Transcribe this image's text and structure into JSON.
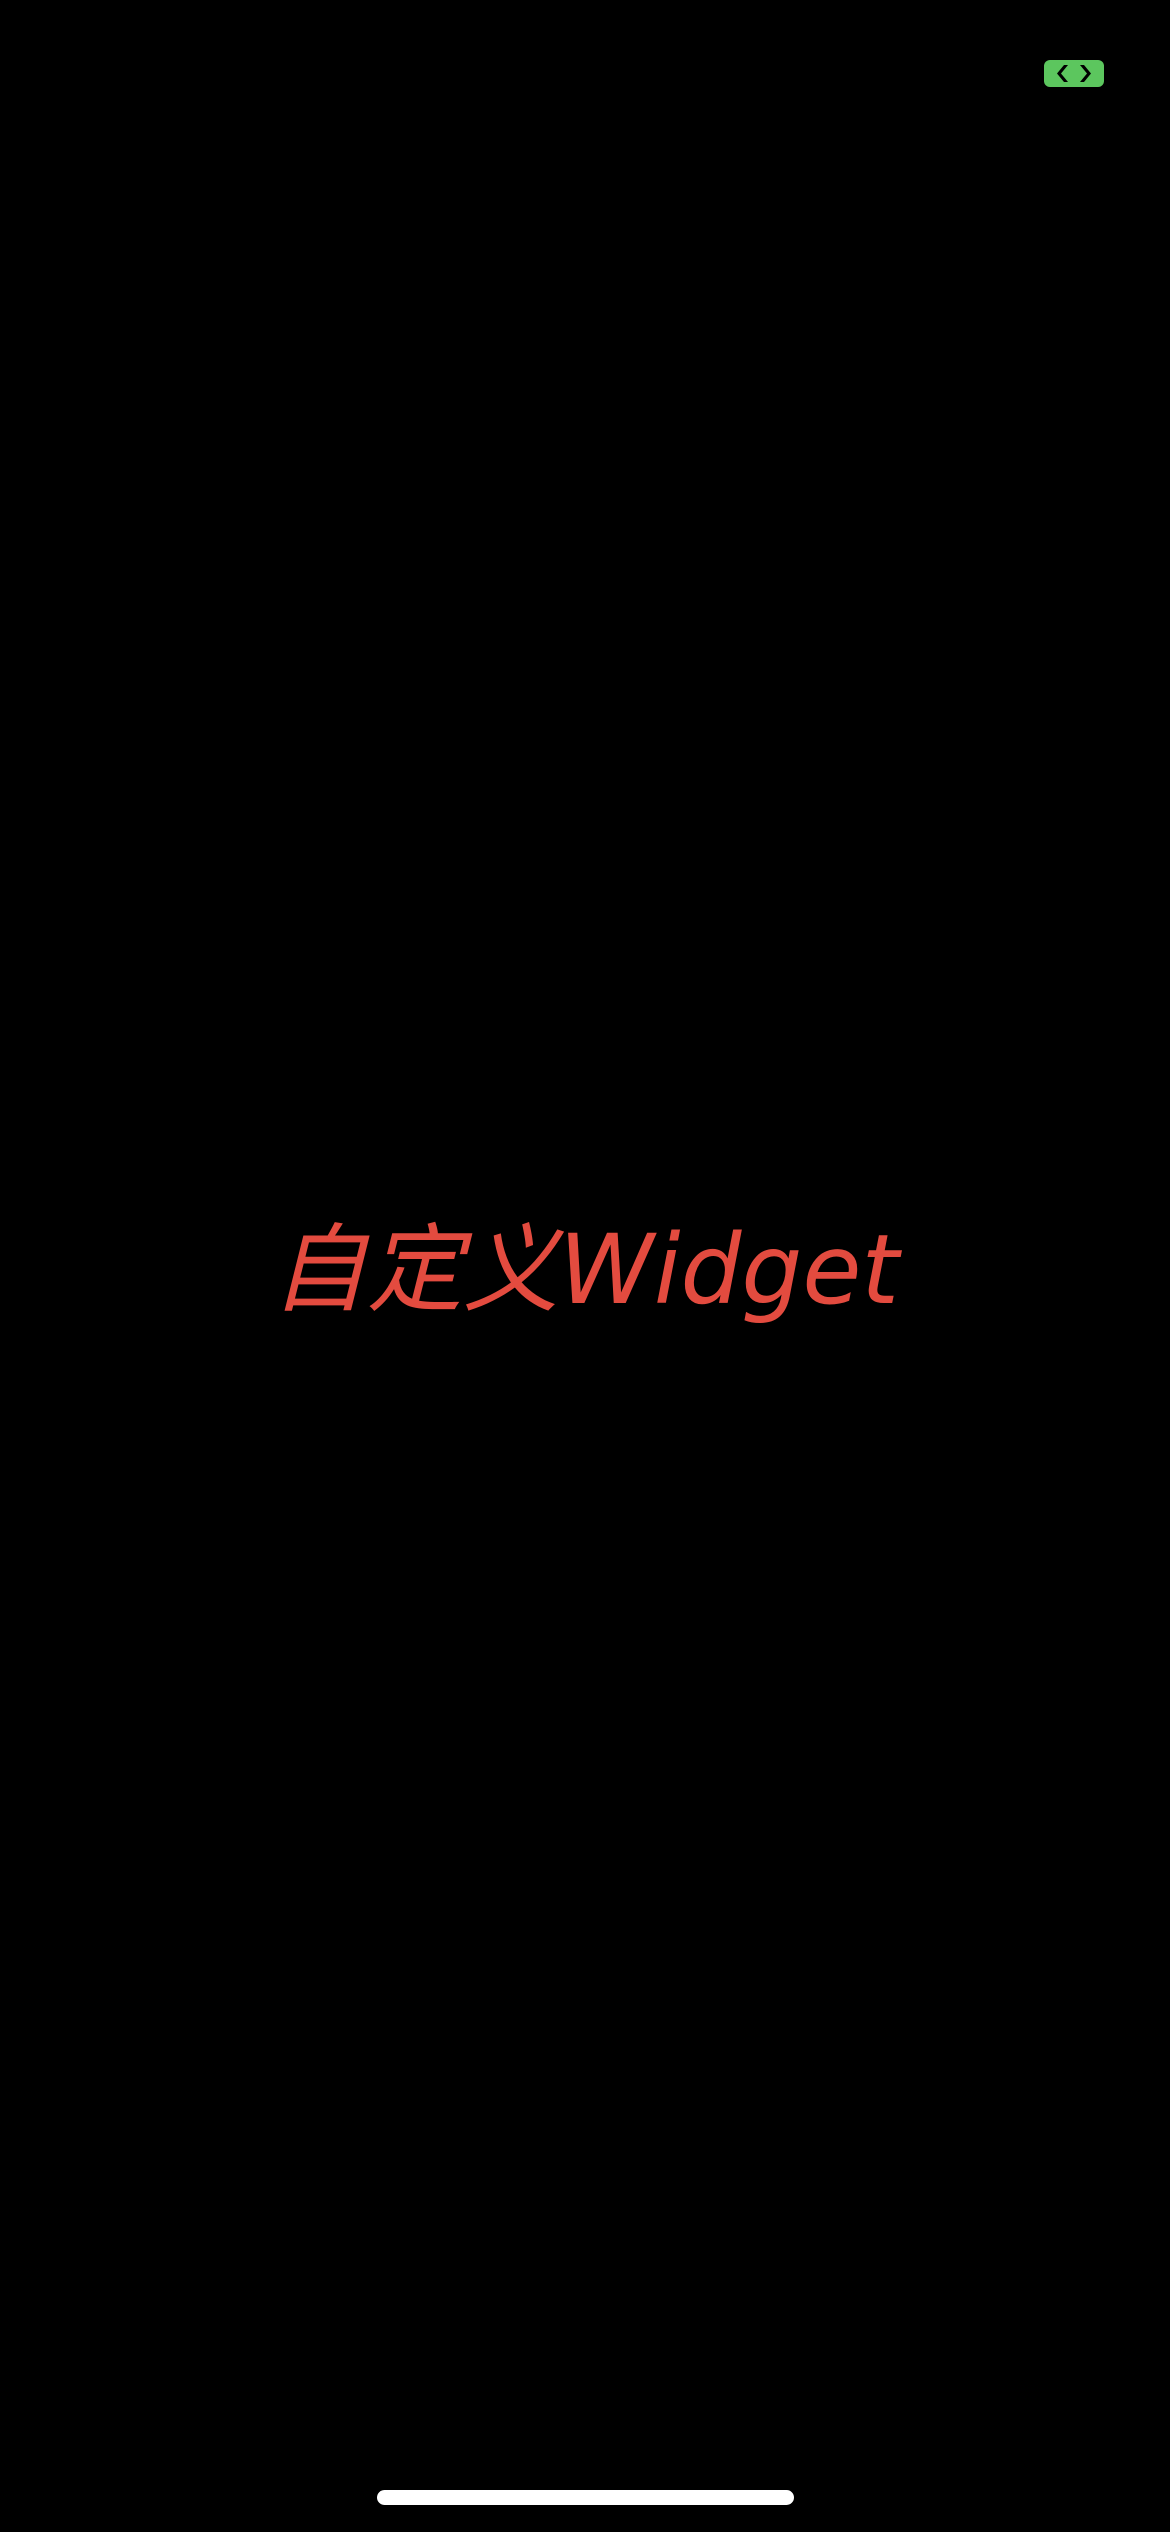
{
  "colors": {
    "background": "#000000",
    "title_text": "#E34B3F",
    "indicator": "#5CC65E",
    "home_indicator": "#FFFFFF"
  },
  "status_bar": {
    "indicator_icon": "green-camera-in-use-indicator-icon"
  },
  "main": {
    "title": "自定义Widget"
  },
  "home_indicator": {
    "icon": "home-indicator-bar"
  }
}
